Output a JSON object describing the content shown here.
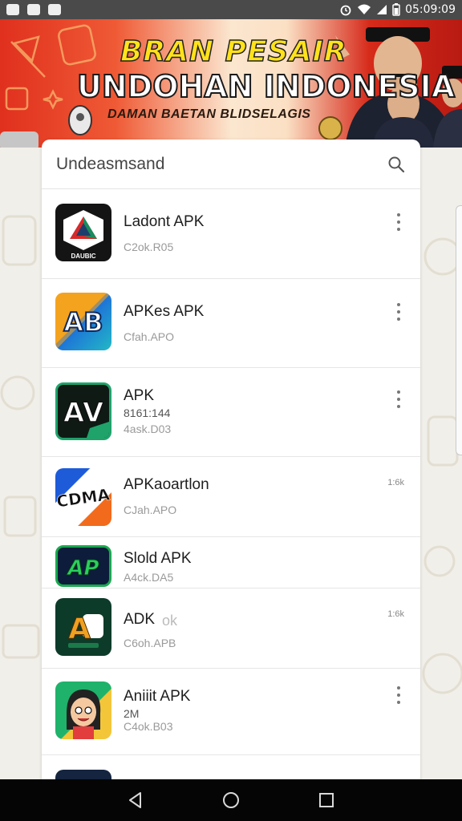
{
  "status_bar": {
    "time": "05:09:09",
    "left_icons": [
      "notification-icon-1",
      "notification-icon-2",
      "notification-icon-3"
    ],
    "right_icons": [
      "alarm-icon",
      "wifi-icon",
      "signal-icon",
      "battery-icon"
    ]
  },
  "banner": {
    "title_line1": "BRAN PESAIR",
    "title_line2": "UNDOHAN INDONESIA",
    "subtitle": "DAMAN BAETAN BLIDSELAGIS",
    "colors": {
      "red": "#e0301e",
      "yellow": "#ffe21a"
    }
  },
  "search": {
    "label": "Undeasmsand",
    "icon": "search-icon"
  },
  "apps": [
    {
      "name": "Ladont APK",
      "sub": "C2ok.R05",
      "meta": "",
      "hint": "",
      "badge": "",
      "menu": true,
      "icon": "triangle-emblem-icon",
      "icon_caption": "DAUBIC"
    },
    {
      "name": "APKes APK",
      "sub": "Cfah.APO",
      "meta": "",
      "hint": "",
      "badge": "",
      "menu": true,
      "icon": "ab-letters-icon",
      "icon_caption": "AB"
    },
    {
      "name": "APK",
      "sub": "4ask.D03",
      "meta": "8161:144",
      "hint": "",
      "badge": "",
      "menu": true,
      "icon": "avi-letters-icon",
      "icon_caption": "AV"
    },
    {
      "name": "APKaoartlon",
      "sub": "CJah.APO",
      "meta": "",
      "hint": "",
      "badge": "1:6k",
      "menu": false,
      "icon": "cdma-letters-icon",
      "icon_caption": "CDMA"
    },
    {
      "name": "Slold APK",
      "sub": "A4ck.DA5",
      "meta": "",
      "hint": "",
      "badge": "",
      "menu": false,
      "icon": "ap-letters-icon",
      "icon_caption": "AP"
    },
    {
      "name": "ADK",
      "sub": "C6oh.APB",
      "meta": "",
      "hint": "ok",
      "badge": "1:6k",
      "menu": false,
      "icon": "ab-green-icon",
      "icon_caption": "A"
    },
    {
      "name": "Aniiit APK",
      "sub": "C4ok.B03",
      "meta": "2M",
      "hint": "",
      "badge": "",
      "menu": true,
      "icon": "cartoon-face-icon",
      "icon_caption": ""
    }
  ],
  "nav": {
    "back": "back-icon",
    "home": "home-icon",
    "recents": "recents-icon"
  }
}
